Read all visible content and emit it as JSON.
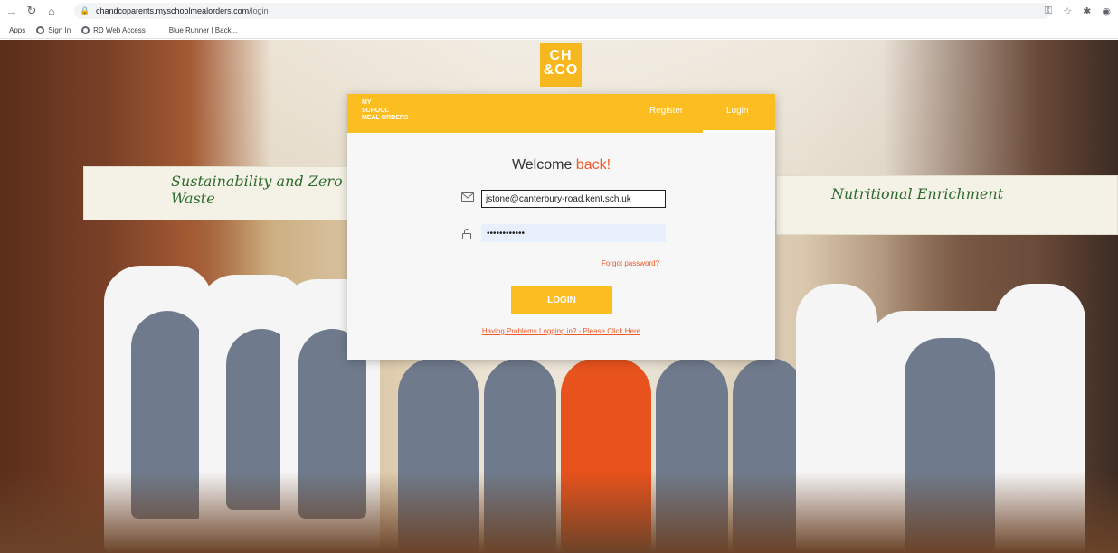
{
  "browser": {
    "url_host": "chandcoparents.myschoolmealorders.com",
    "url_path": "/login",
    "bookmarks": [
      "Apps",
      "Sign In",
      "RD Web Access",
      "Blue Runner | Back..."
    ]
  },
  "logo": {
    "line1": "CH",
    "line2": "&CO"
  },
  "header": {
    "brand_line1": "MY",
    "brand_line2": "SCHOOL",
    "brand_line3": "MEAL ORDERS",
    "register_label": "Register",
    "login_label": "Login"
  },
  "form": {
    "welcome_prefix": "Welcome",
    "welcome_accent": "back!",
    "email_value": "jstone@canterbury-road.kent.sch.uk",
    "password_value": "••••••••••••",
    "forgot_label": "Forgot password?",
    "login_button": "LOGIN",
    "problems_link": "Having Problems Logging in? - Please Click Here"
  },
  "background": {
    "banner_left": "Sustainability and Zero Waste",
    "banner_right": "Nutritional Enrichment"
  },
  "colors": {
    "brand_yellow": "#fbbd1f",
    "accent_orange": "#ef5a2a",
    "autofill_blue": "#e8f0fe"
  }
}
